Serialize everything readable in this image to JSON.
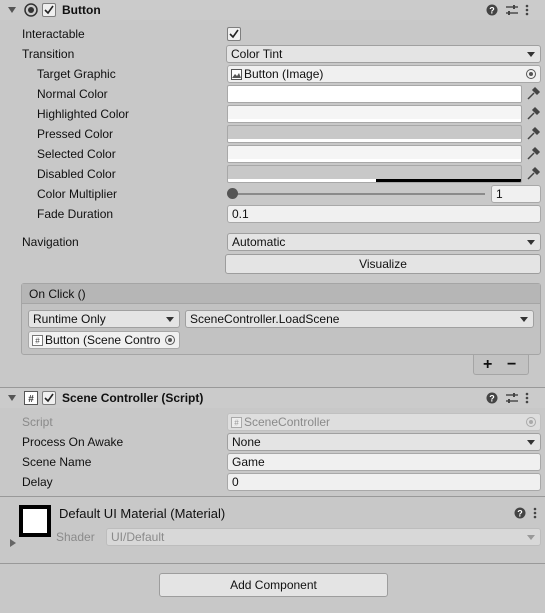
{
  "button_component": {
    "title": "Button",
    "enabled": true,
    "interactable": {
      "label": "Interactable",
      "checked": true
    },
    "transition": {
      "label": "Transition",
      "value": "Color Tint"
    },
    "target_graphic": {
      "label": "Target Graphic",
      "value": "Button (Image)"
    },
    "normal_color": {
      "label": "Normal Color",
      "color": "#ffffff"
    },
    "highlighted_color": {
      "label": "Highlighted Color",
      "color": "#f5f5f5"
    },
    "pressed_color": {
      "label": "Pressed Color",
      "color": "#c8c8c8"
    },
    "selected_color": {
      "label": "Selected Color",
      "color": "#f5f5f5"
    },
    "disabled_color": {
      "label": "Disabled Color",
      "color": "#c8c8c8"
    },
    "color_multiplier": {
      "label": "Color Multiplier",
      "value": "1",
      "slider_fraction": 0.0
    },
    "fade_duration": {
      "label": "Fade Duration",
      "value": "0.1"
    },
    "navigation": {
      "label": "Navigation",
      "value": "Automatic"
    },
    "visualize_label": "Visualize",
    "on_click": {
      "header": "On Click ()",
      "runtime": "Runtime Only",
      "function": "SceneController.LoadScene",
      "object": "Button (Scene Contro",
      "add_label": "+",
      "remove_label": "−"
    }
  },
  "scene_controller": {
    "title": "Scene Controller (Script)",
    "enabled": true,
    "script": {
      "label": "Script",
      "value": "SceneController"
    },
    "process_on_awake": {
      "label": "Process On Awake",
      "value": "None"
    },
    "scene_name": {
      "label": "Scene Name",
      "value": "Game"
    },
    "delay": {
      "label": "Delay",
      "value": "0"
    }
  },
  "material": {
    "title": "Default UI Material (Material)",
    "shader_label": "Shader",
    "shader_value": "UI/Default"
  },
  "add_component_label": "Add Component"
}
